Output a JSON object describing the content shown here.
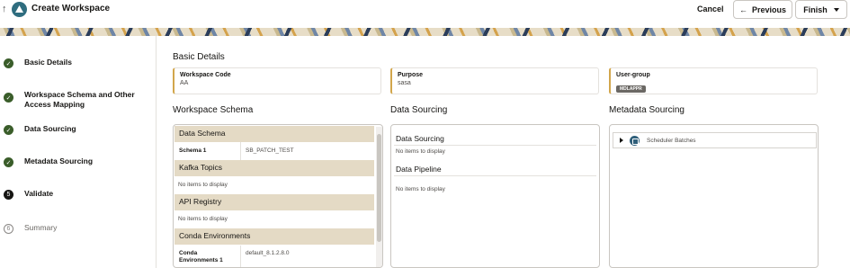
{
  "header": {
    "title": "Create Workspace",
    "cancel_label": "Cancel",
    "previous_label": "Previous",
    "finish_label": "Finish"
  },
  "steps": [
    {
      "label": "Basic Details",
      "state": "done"
    },
    {
      "label": "Workspace Schema and Other Access Mapping",
      "state": "done"
    },
    {
      "label": "Data Sourcing",
      "state": "done"
    },
    {
      "label": "Metadata Sourcing",
      "state": "done"
    },
    {
      "label": "Validate",
      "state": "current",
      "number": "5"
    },
    {
      "label": "Summary",
      "state": "pending",
      "number": "6"
    }
  ],
  "basic_details": {
    "title": "Basic Details",
    "workspace_code": {
      "label": "Workspace Code",
      "value": "AA"
    },
    "purpose": {
      "label": "Purpose",
      "value": "sasa"
    },
    "user_group": {
      "label": "User-group",
      "value": "MDLAPPR"
    }
  },
  "workspace_schema": {
    "title": "Workspace Schema",
    "data_schema": {
      "header": "Data Schema",
      "row_label": "Schema 1",
      "row_value": "SB_PATCH_TEST"
    },
    "kafka_topics": {
      "header": "Kafka Topics",
      "empty": "No items to display"
    },
    "api_registry": {
      "header": "API Registry",
      "empty": "No items to display"
    },
    "conda_environments": {
      "header": "Conda Environments",
      "row_label": "Conda Environments 1",
      "row_value": "default_8.1.2.8.0"
    }
  },
  "data_sourcing": {
    "title": "Data Sourcing",
    "sourcing": {
      "header": "Data Sourcing",
      "empty": "No items to display"
    },
    "pipeline": {
      "header": "Data Pipeline",
      "empty": "No items to display"
    }
  },
  "metadata_sourcing": {
    "title": "Metadata Sourcing",
    "tree_item": "Scheduler Batches"
  },
  "colors": {
    "accent": "#d2a64c",
    "step_done": "#3a5d2a",
    "group_header": "#e4dac5"
  }
}
